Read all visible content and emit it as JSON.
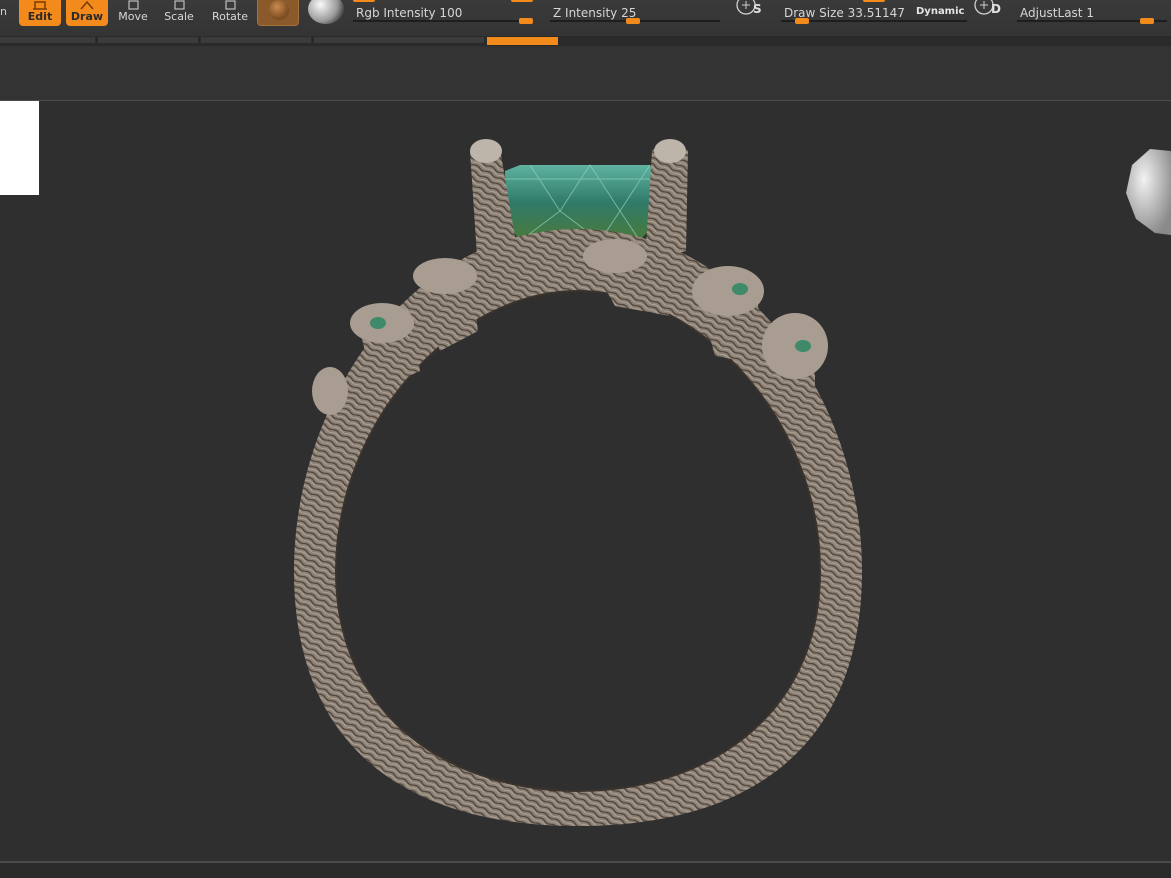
{
  "toolbar": {
    "edge_char": "n",
    "buttons": [
      {
        "label": "Edit",
        "active": true
      },
      {
        "label": "Draw",
        "active": true
      },
      {
        "label": "Move",
        "active": false
      },
      {
        "label": "Scale",
        "active": false
      },
      {
        "label": "Rotate",
        "active": false
      }
    ],
    "sliders": {
      "rgb_intensity": {
        "label": "Rgb Intensity 100",
        "value": 100,
        "max": 100
      },
      "z_intensity": {
        "label": "Z Intensity 25",
        "value": 25,
        "max": 100
      },
      "draw_size": {
        "label": "Draw Size 33.51147",
        "value": 33.51147
      },
      "adjust_last": {
        "label": "AdjustLast 1",
        "value": 1
      }
    },
    "dynamic_label": "Dynamic",
    "s_letter": "S",
    "d_letter": "D",
    "accent_color": "#f28a1c"
  },
  "viewport": {
    "subject": "3D ring model with green gemstone and textured bark-like band",
    "background_color": "#2f2f30",
    "gem_color": "#3c8a78",
    "metal_color": "#8d8276"
  }
}
